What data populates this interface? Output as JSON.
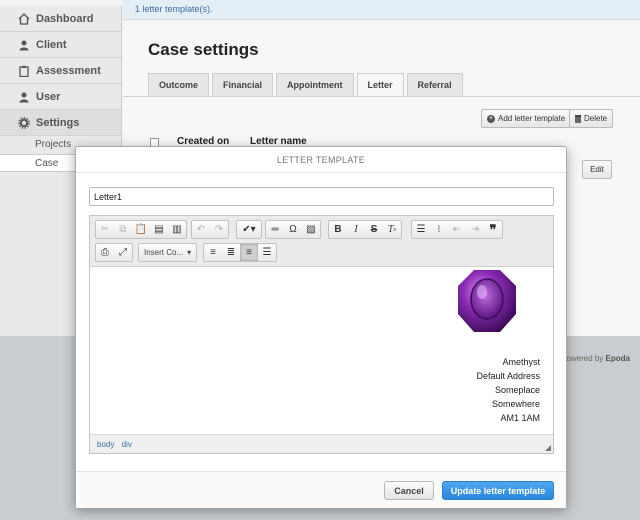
{
  "topbar": {
    "message": "1 letter template(s)."
  },
  "sidebar": {
    "items": [
      {
        "label": "Dashboard",
        "icon": "home-icon"
      },
      {
        "label": "Client",
        "icon": "user-icon"
      },
      {
        "label": "Assessment",
        "icon": "clipboard-icon"
      },
      {
        "label": "User",
        "icon": "user-icon"
      },
      {
        "label": "Settings",
        "icon": "gear-icon"
      }
    ],
    "subitems": [
      {
        "label": "Projects"
      },
      {
        "label": "Case"
      }
    ]
  },
  "main": {
    "title": "Case settings",
    "tabs": [
      {
        "label": "Outcome"
      },
      {
        "label": "Financial"
      },
      {
        "label": "Appointment"
      },
      {
        "label": "Letter"
      },
      {
        "label": "Referral"
      }
    ],
    "active_tab": "Letter",
    "actions": {
      "add_label": "Add letter template",
      "delete_label": "Delete"
    },
    "table": {
      "columns": [
        "Created on",
        "Letter name"
      ],
      "edit_label": "Edit"
    },
    "powered_prefix": "Powered by",
    "powered_brand": "Epoda"
  },
  "modal": {
    "title": "LETTER TEMPLATE",
    "name_value": "Letter1",
    "toolbar": {
      "format_combo": "Insert Co...",
      "icons": [
        "cut-icon",
        "copy-icon",
        "paste-icon",
        "paste-text-icon",
        "paste-word-icon",
        "undo-icon",
        "redo-icon",
        "spellcheck-icon",
        "horizontal-rule-icon",
        "special-char-icon",
        "image-icon",
        "bold-icon",
        "italic-icon",
        "strikethrough-icon",
        "remove-format-icon",
        "numbered-list-icon",
        "bulleted-list-icon",
        "outdent-icon",
        "indent-icon",
        "blockquote-icon",
        "print-icon",
        "maximize-icon",
        "align-left-icon",
        "align-center-icon",
        "align-right-icon",
        "justify-icon"
      ]
    },
    "letter": {
      "lines": [
        "Amethyst",
        "Default Address",
        "Someplace",
        "Somewhere",
        "AM1 1AM"
      ]
    },
    "statusbar": {
      "path": [
        "body",
        "div"
      ]
    },
    "cancel_label": "Cancel",
    "submit_label": "Update letter template"
  },
  "colors": {
    "accent": "#2b87dc",
    "link": "#3a6ea5",
    "gem": "#8a2bb5"
  }
}
